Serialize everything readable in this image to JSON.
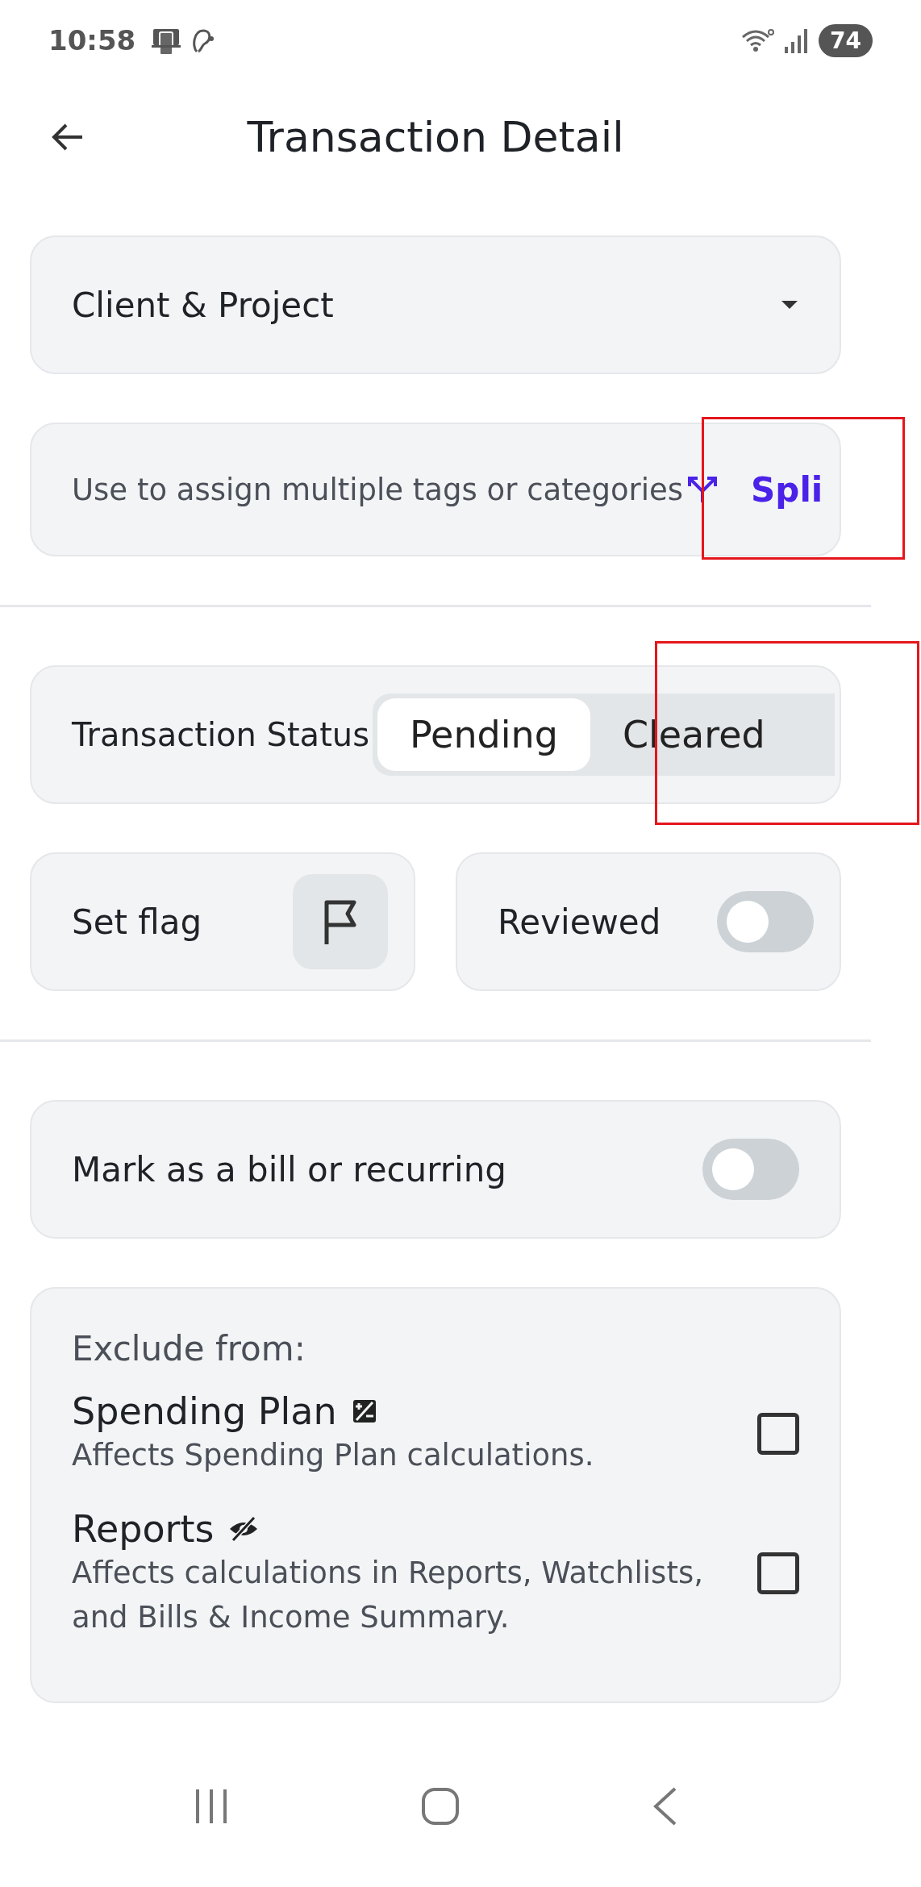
{
  "status_bar": {
    "time": "10:58",
    "battery": "74"
  },
  "header": {
    "title": "Transaction Detail"
  },
  "client_project": {
    "label": "Client & Project"
  },
  "split": {
    "hint": "Use to assign multiple tags or categories",
    "action": "Spli"
  },
  "transaction_status": {
    "label": "Transaction Status",
    "options": [
      {
        "label": "Pending",
        "selected": true
      },
      {
        "label": "Cleared",
        "selected": false
      }
    ]
  },
  "flag": {
    "label": "Set flag"
  },
  "reviewed": {
    "label": "Reviewed",
    "on": false
  },
  "bill": {
    "label": "Mark as a bill or recurring",
    "on": false
  },
  "exclude": {
    "title": "Exclude from:",
    "items": [
      {
        "kind": "plan",
        "name": "Spending Plan",
        "description": "Affects Spending Plan calculations.",
        "checked": false
      },
      {
        "kind": "reports",
        "name": "Reports",
        "description": "Affects calculations in Reports, Watchlists, and Bills & Income Summary.",
        "checked": false
      }
    ]
  }
}
